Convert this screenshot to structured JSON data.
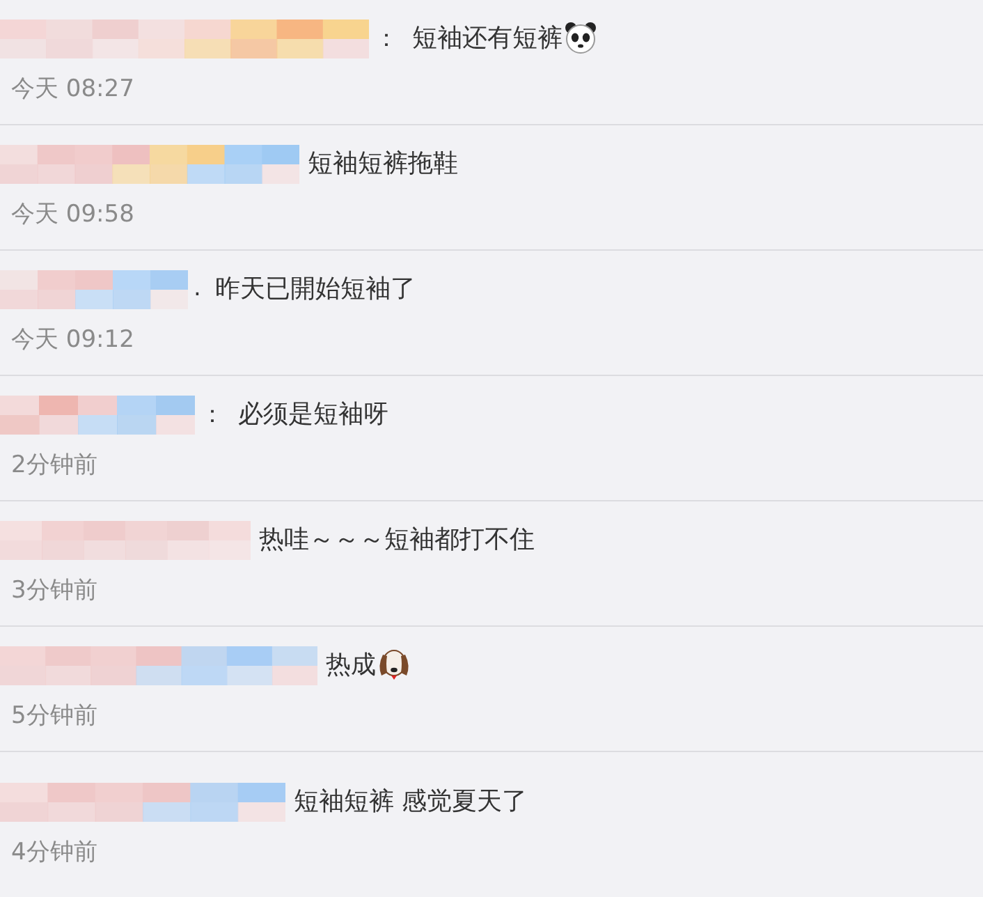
{
  "comments": [
    {
      "separator": "：",
      "text": "短袖还有短裤",
      "time": "今天 08:27"
    },
    {
      "text": "短袖短裤拖鞋",
      "time": "今天 09:58"
    },
    {
      "separator": ".",
      "text": "昨天已開始短袖了",
      "time": "今天 09:12"
    },
    {
      "separator": "：",
      "text": "必须是短袖呀",
      "time": "2分钟前"
    },
    {
      "text": "热哇～～～短袖都打不住",
      "time": "3分钟前"
    },
    {
      "text": "热成",
      "time": "5分钟前"
    },
    {
      "text": "短袖短裤 感觉夏天了",
      "time": "4分钟前"
    }
  ]
}
